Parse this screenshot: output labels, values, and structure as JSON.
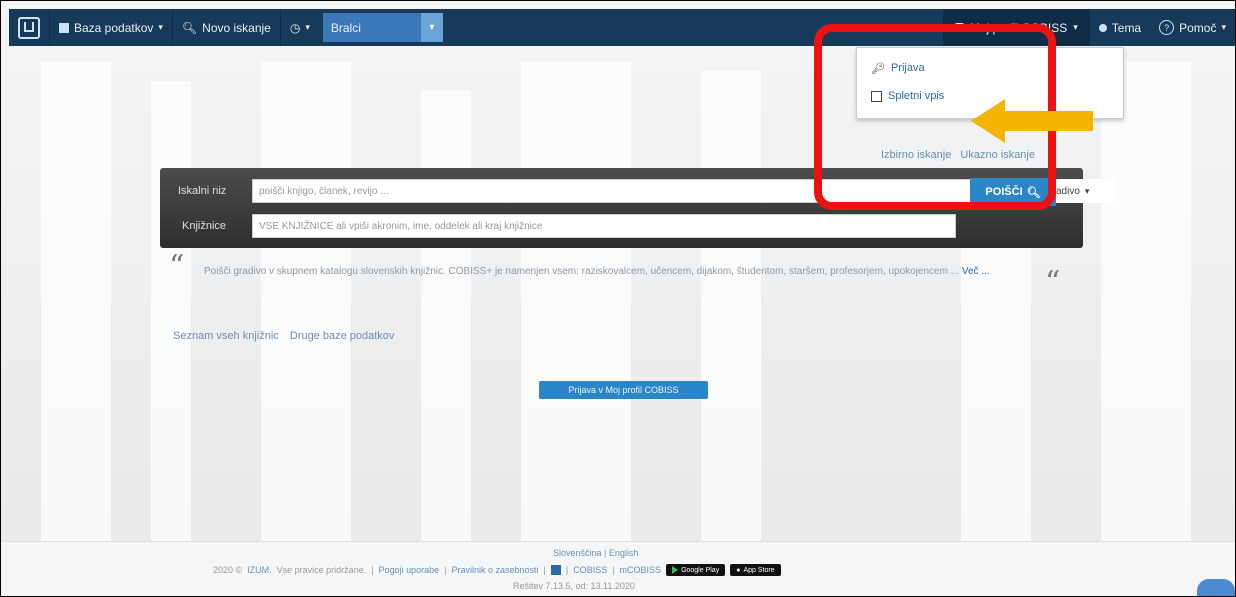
{
  "topbar": {
    "logo": "cobiss-logo",
    "database_label": "Baza podatkov",
    "new_search_label": "Novo iskanje",
    "history_label": "",
    "combo_value": "Bralci",
    "profile_label": "Moj profil COBISS",
    "theme_label": "Tema",
    "help_label": "Pomoč"
  },
  "dropdown": {
    "items": [
      {
        "label": "Prijava",
        "icon": "key-icon"
      },
      {
        "label": "Spletni vpis",
        "icon": "sign-in-icon"
      }
    ]
  },
  "annotations": {
    "highlight_color": "#ee1111",
    "arrow_color": "#f5b400"
  },
  "search": {
    "advanced_link": "Izbirno iskanje",
    "command_link": "Ukazno iskanje",
    "query_label": "Iskalni niz",
    "query_placeholder": "poišči knjigo, članek, revijo ...",
    "material_select": "vse gradivo",
    "search_button": "POIŠČI",
    "libraries_label": "Knjižnice",
    "libraries_placeholder": "VSE KNJIŽNICE ali vpiši akronim, ime, oddelek ali kraj knjižnice"
  },
  "quote": {
    "text": "Poišči gradivo v skupnem katalogu slovenskih knjižnic. COBISS+ je namenjen vsem: raziskovalcem, učencem, dijakom, študentom, staršem, profesorjem, upokojencem ...",
    "more": "Več ..."
  },
  "links": {
    "all_libraries": "Seznam vseh knjižnic",
    "other_databases": "Druge baze podatkov"
  },
  "login_button": "Prijava v Moj profil COBISS",
  "footer": {
    "lang_sl": "Slovenščina",
    "lang_en": "English",
    "copyright_year": "2020 ©",
    "izum": "IZUM.",
    "rights": "Vse pravice pridržane.",
    "terms": "Pogoji uporabe",
    "cookies": "Pravilnik o zasebnosti",
    "cobiss": "COBISS",
    "mcobiss": "mCOBISS",
    "google_play": "Google Play",
    "app_store": "App Store",
    "version": "Rešitev 7.13.5, od: 13.11.2020"
  }
}
